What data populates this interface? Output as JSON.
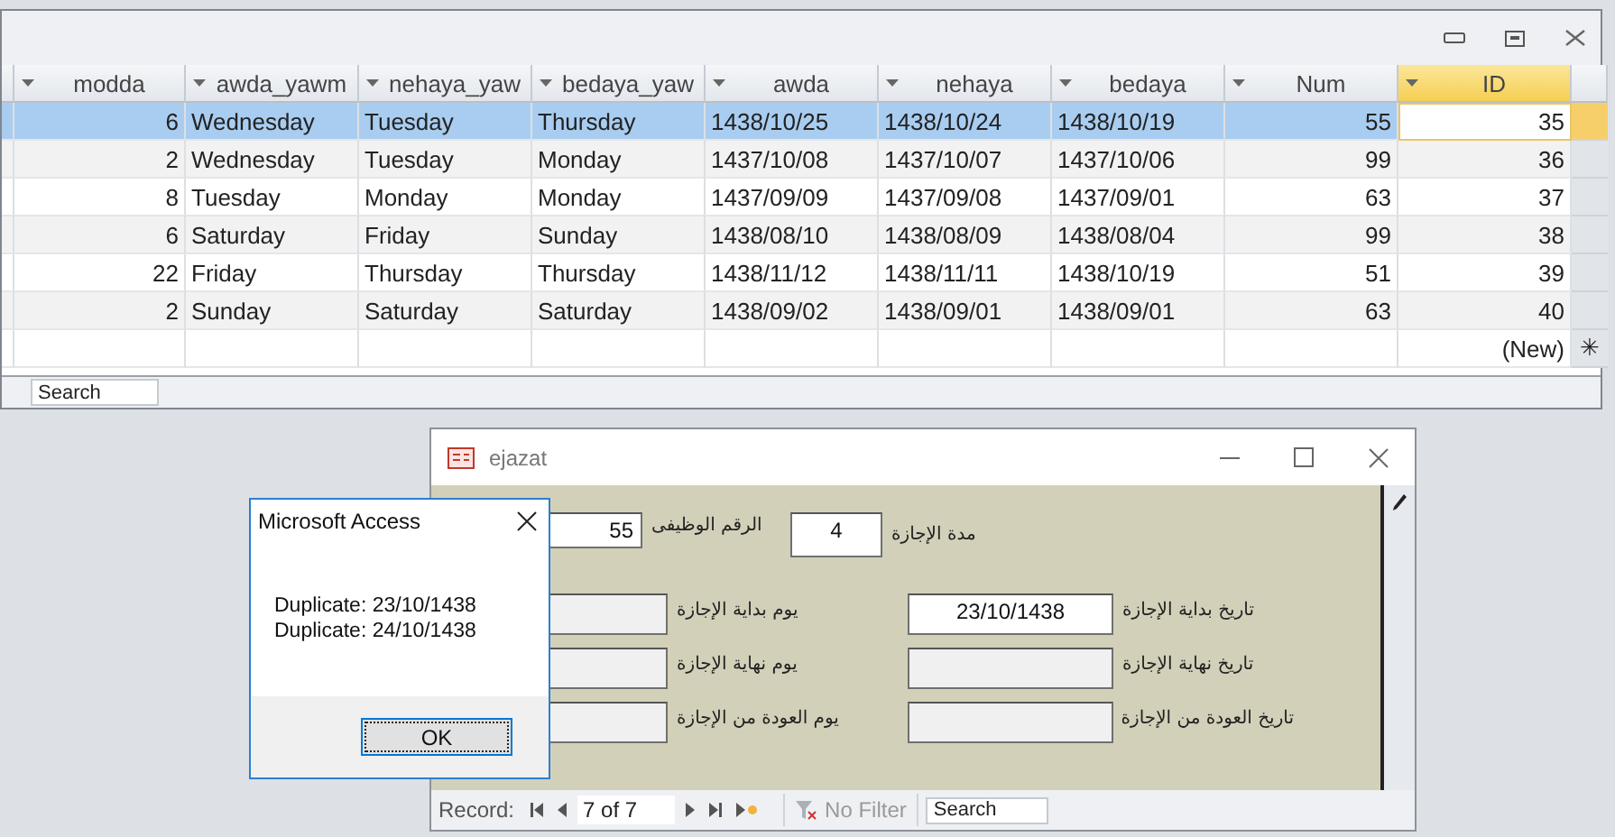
{
  "datasheet": {
    "columns": [
      {
        "label": "modda",
        "kind": "number",
        "selected": false
      },
      {
        "label": "awda_yawm",
        "kind": "text",
        "selected": false
      },
      {
        "label": "nehaya_yaw",
        "kind": "text",
        "selected": false
      },
      {
        "label": "bedaya_yaw",
        "kind": "text",
        "selected": false
      },
      {
        "label": "awda",
        "kind": "text",
        "selected": false
      },
      {
        "label": "nehaya",
        "kind": "text",
        "selected": false
      },
      {
        "label": "bedaya",
        "kind": "text",
        "selected": false
      },
      {
        "label": "Num",
        "kind": "number",
        "selected": false
      },
      {
        "label": "ID",
        "kind": "number",
        "selected": true
      }
    ],
    "rows": [
      {
        "selected": true,
        "cells": [
          "6",
          "Wednesday",
          "Tuesday",
          "Thursday",
          "1438/10/25",
          "1438/10/24",
          "1438/10/19",
          "55",
          "35"
        ]
      },
      {
        "selected": false,
        "cells": [
          "2",
          "Wednesday",
          "Tuesday",
          "Monday",
          "1437/10/08",
          "1437/10/07",
          "1437/10/06",
          "99",
          "36"
        ]
      },
      {
        "selected": false,
        "cells": [
          "8",
          "Tuesday",
          "Monday",
          "Monday",
          "1437/09/09",
          "1437/09/08",
          "1437/09/01",
          "63",
          "37"
        ]
      },
      {
        "selected": false,
        "cells": [
          "6",
          "Saturday",
          "Friday",
          "Sunday",
          "1438/08/10",
          "1438/08/09",
          "1438/08/04",
          "99",
          "38"
        ]
      },
      {
        "selected": false,
        "cells": [
          "22",
          "Friday",
          "Thursday",
          "Thursday",
          "1438/11/12",
          "1438/11/11",
          "1438/10/19",
          "51",
          "39"
        ]
      },
      {
        "selected": false,
        "cells": [
          "2",
          "Sunday",
          "Saturday",
          "Saturday",
          "1438/09/02",
          "1438/09/01",
          "1438/09/01",
          "63",
          "40"
        ]
      }
    ],
    "new_row": {
      "label": "(New)",
      "marker": "✳"
    },
    "search": {
      "placeholder": "Search"
    }
  },
  "form": {
    "title": "ejazat",
    "employee_number": {
      "label": "الرقم الوظيفى",
      "value": "55",
      "disabled": false
    },
    "duration": {
      "label": "مدة الإجازة",
      "value": "4",
      "disabled": false
    },
    "rows": [
      {
        "day_label": "يوم بداية الإجازة",
        "day_value_disabled": true,
        "date_label": "تاريخ بداية الإجازة",
        "date_value": "23/10/1438",
        "date_disabled": false
      },
      {
        "day_label": "يوم نهاية الإجازة",
        "day_value_disabled": true,
        "date_label": "تاريخ نهاية الإجازة",
        "date_disabled": true
      },
      {
        "day_label": "يوم العودة من الإجازة",
        "day_value_disabled": true,
        "date_label": "تاريخ العودة من الإجازة",
        "date_disabled": true
      }
    ],
    "navigation": {
      "label": "Record:",
      "position": "7 of 7",
      "filter": "No Filter",
      "filter_disabled": true,
      "search_placeholder": "Search"
    }
  },
  "dialog": {
    "title": "Microsoft Access",
    "lines": [
      "Duplicate: 23/10/1438",
      "Duplicate: 24/10/1438"
    ],
    "buttons": [
      "OK"
    ]
  }
}
